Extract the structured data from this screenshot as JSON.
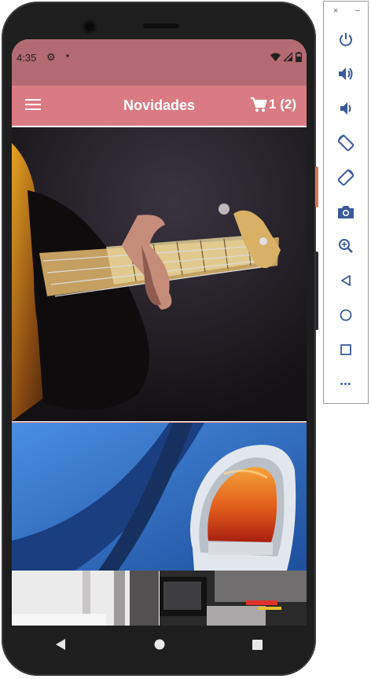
{
  "status_bar": {
    "time": "4:35",
    "dot": "•"
  },
  "app_bar": {
    "title": "Novidades",
    "cart_text": "1 (2)"
  },
  "toolbar": {
    "close": "×",
    "minimize": "−",
    "more": "•••"
  },
  "colors": {
    "status_bar": "#b46a72",
    "app_bar": "#da7b83",
    "phone_body": "#1e1e1f"
  },
  "products": [
    {
      "name": "bass-guitar-photo"
    },
    {
      "name": "blue-car-tail-light-photo"
    },
    {
      "name": "desk-photo"
    },
    {
      "name": "laptop-photo"
    }
  ],
  "icons": {
    "toolbar": [
      "power-icon",
      "volume-up-icon",
      "volume-down-icon",
      "rotate-left-icon",
      "rotate-right-icon",
      "camera-icon",
      "zoom-icon",
      "back-icon",
      "home-icon",
      "overview-icon",
      "more-icon"
    ]
  }
}
